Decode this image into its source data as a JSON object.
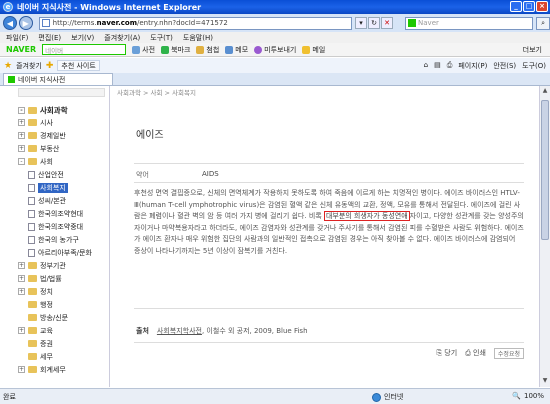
{
  "window": {
    "title": "네이버 지식사전 - Windows Internet Explorer",
    "controls": [
      "_",
      "□",
      "×"
    ]
  },
  "address_bar": {
    "url_prefix": "http://terms.",
    "url_domain": "naver.com",
    "url_path": "/entry.nhn?docId=471572",
    "search_placeholder": "Naver"
  },
  "menu": [
    "파일(F)",
    "편집(E)",
    "보기(V)",
    "즐겨찾기(A)",
    "도구(T)",
    "도움말(H)"
  ],
  "naver_toolbar": {
    "logo": "NAVER",
    "search_placeholder": "네이버",
    "items": [
      "사전",
      "북마크",
      "첨첩",
      "메모",
      "미투보내기",
      "메일"
    ],
    "more": "더보기"
  },
  "favorites_bar": {
    "favorites_label": "즐겨찾기",
    "suggested_sites": "추천 사이트",
    "tools": [
      "페이지(P)",
      "안전(S)",
      "도구(O)"
    ]
  },
  "tab": {
    "label": "네이버 지식사전"
  },
  "sidebar": {
    "root": "사회과학",
    "items": [
      {
        "label": "시사",
        "level": 1,
        "type": "folder",
        "toggle": "+"
      },
      {
        "label": "경제일반",
        "level": 1,
        "type": "folder",
        "toggle": "+"
      },
      {
        "label": "부동산",
        "level": 1,
        "type": "folder",
        "toggle": "+"
      },
      {
        "label": "사회",
        "level": 1,
        "type": "folder",
        "toggle": "-"
      },
      {
        "label": "산업안전",
        "level": 2,
        "type": "doc"
      },
      {
        "label": "사회복지",
        "level": 2,
        "type": "doc",
        "selected": true
      },
      {
        "label": "성씨/본관",
        "level": 2,
        "type": "doc"
      },
      {
        "label": "한국의조약현대",
        "level": 2,
        "type": "doc"
      },
      {
        "label": "한국의조약중대",
        "level": 2,
        "type": "doc"
      },
      {
        "label": "한국의 농가구",
        "level": 2,
        "type": "doc"
      },
      {
        "label": "아르리아부족/문화",
        "level": 2,
        "type": "doc"
      },
      {
        "label": "정부기관",
        "level": 1,
        "type": "folder",
        "toggle": "+"
      },
      {
        "label": "법/법률",
        "level": 1,
        "type": "folder",
        "toggle": "+"
      },
      {
        "label": "정치",
        "level": 1,
        "type": "folder",
        "toggle": "+"
      },
      {
        "label": "행정",
        "level": 1,
        "type": "folder",
        "toggle": ""
      },
      {
        "label": "방송/신문",
        "level": 1,
        "type": "folder",
        "toggle": ""
      },
      {
        "label": "교육",
        "level": 1,
        "type": "folder",
        "toggle": "+"
      },
      {
        "label": "증권",
        "level": 1,
        "type": "folder",
        "toggle": ""
      },
      {
        "label": "세무",
        "level": 1,
        "type": "folder",
        "toggle": ""
      },
      {
        "label": "회계세무",
        "level": 1,
        "type": "folder",
        "toggle": "+"
      }
    ]
  },
  "article": {
    "breadcrumb": "사회과학 > 사회 > 사회복지",
    "title": "에이즈",
    "meta_label": "약어",
    "meta_value": "AIDS",
    "body_before": "후천성 면역 결핍증으로, 신체의 면역체계가 작용하지 못하도록 하여 죽음에 이르게 하는 치명적인 병이다. 에이즈 바이러스인 HTLV-Ⅲ(human T-cell ymphotrophic virus)은 감염된 혈액 같은 신체 유동액의 교환, 정액, 모유를 통해서 전달된다. 에이즈에 걸린 사람은 폐렴이나 혈관 벽의 암 등 여러 가지 병에 걸리기 쉽다. 비록 ",
    "body_highlight": "대부분의 희생자가 동성연애",
    "body_after": "자이고, 다양한 성관계를 갖는 양성주의자이거나 마약복용자라고 하더라도, 에이즈 감염자와 성관계를 갖거나 주사기를 통해서 감염된 피를 수혈받은 사람도 위험하다. 에이즈가 에이즈 환자나 매우 위험한 집단의 사람과의 일반적인 접촉으로 감염된 경우는 아직 찾아볼 수 없다. 에이즈 바이러스에 감염되어 증상이 나타나기까지는 5년 이상이 잠복기를 거친다.",
    "source_label": "출처",
    "source_link": "사회복지학사전",
    "source_rest": ", 이철수 외 공저, 2009, Blue Fish",
    "actions": [
      "당기",
      "인쇄"
    ],
    "edit_request": "수정요청"
  },
  "statusbar": {
    "left": "완료",
    "zone": "인터넷",
    "zoom": "100%"
  }
}
